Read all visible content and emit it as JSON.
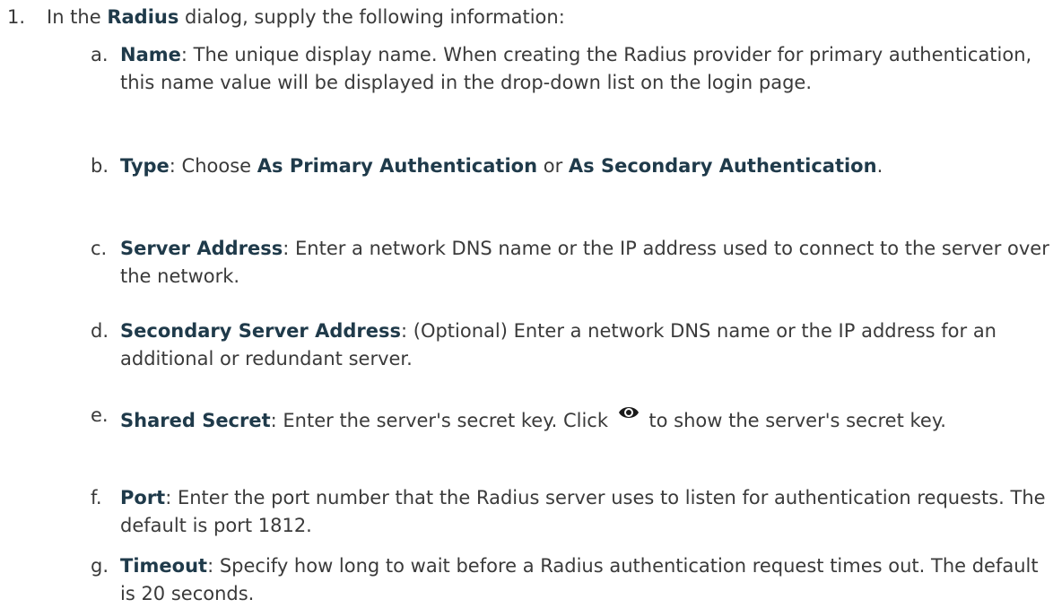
{
  "step": {
    "number": "1.",
    "pre": "In the ",
    "dialog": "Radius",
    "post": " dialog, supply the following information:"
  },
  "items": [
    {
      "letter": "a.",
      "term": "Name",
      "text": ": The unique display name. When creating the Radius provider for primary authentication, this name value will be displayed in the drop-down list on the login page."
    },
    {
      "letter": "b.",
      "term": "Type",
      "text_pre": ": Choose ",
      "option1": "As Primary Authentication",
      "text_mid": " or ",
      "option2": "As Secondary Authentication",
      "text_post": "."
    },
    {
      "letter": "c.",
      "term": "Server Address",
      "text": ": Enter a network DNS name or the IP address used to connect to the server over the network."
    },
    {
      "letter": "d.",
      "term": "Secondary Server Address",
      "text": ": (Optional) Enter a network DNS name or the IP address for an additional or redundant server."
    },
    {
      "letter": "e.",
      "term": "Shared Secret",
      "text_pre": ": Enter the server's secret key. Click ",
      "icon": "eye-icon",
      "text_post": " to show the server's secret key."
    },
    {
      "letter": "f.",
      "term": "Port",
      "text": ": Enter the port number that the Radius server uses to listen for authentication requests. The default is port 1812."
    },
    {
      "letter": "g.",
      "term": "Timeout",
      "text": ": Specify how long to wait before a Radius authentication request times out. The default is 20 seconds."
    }
  ]
}
